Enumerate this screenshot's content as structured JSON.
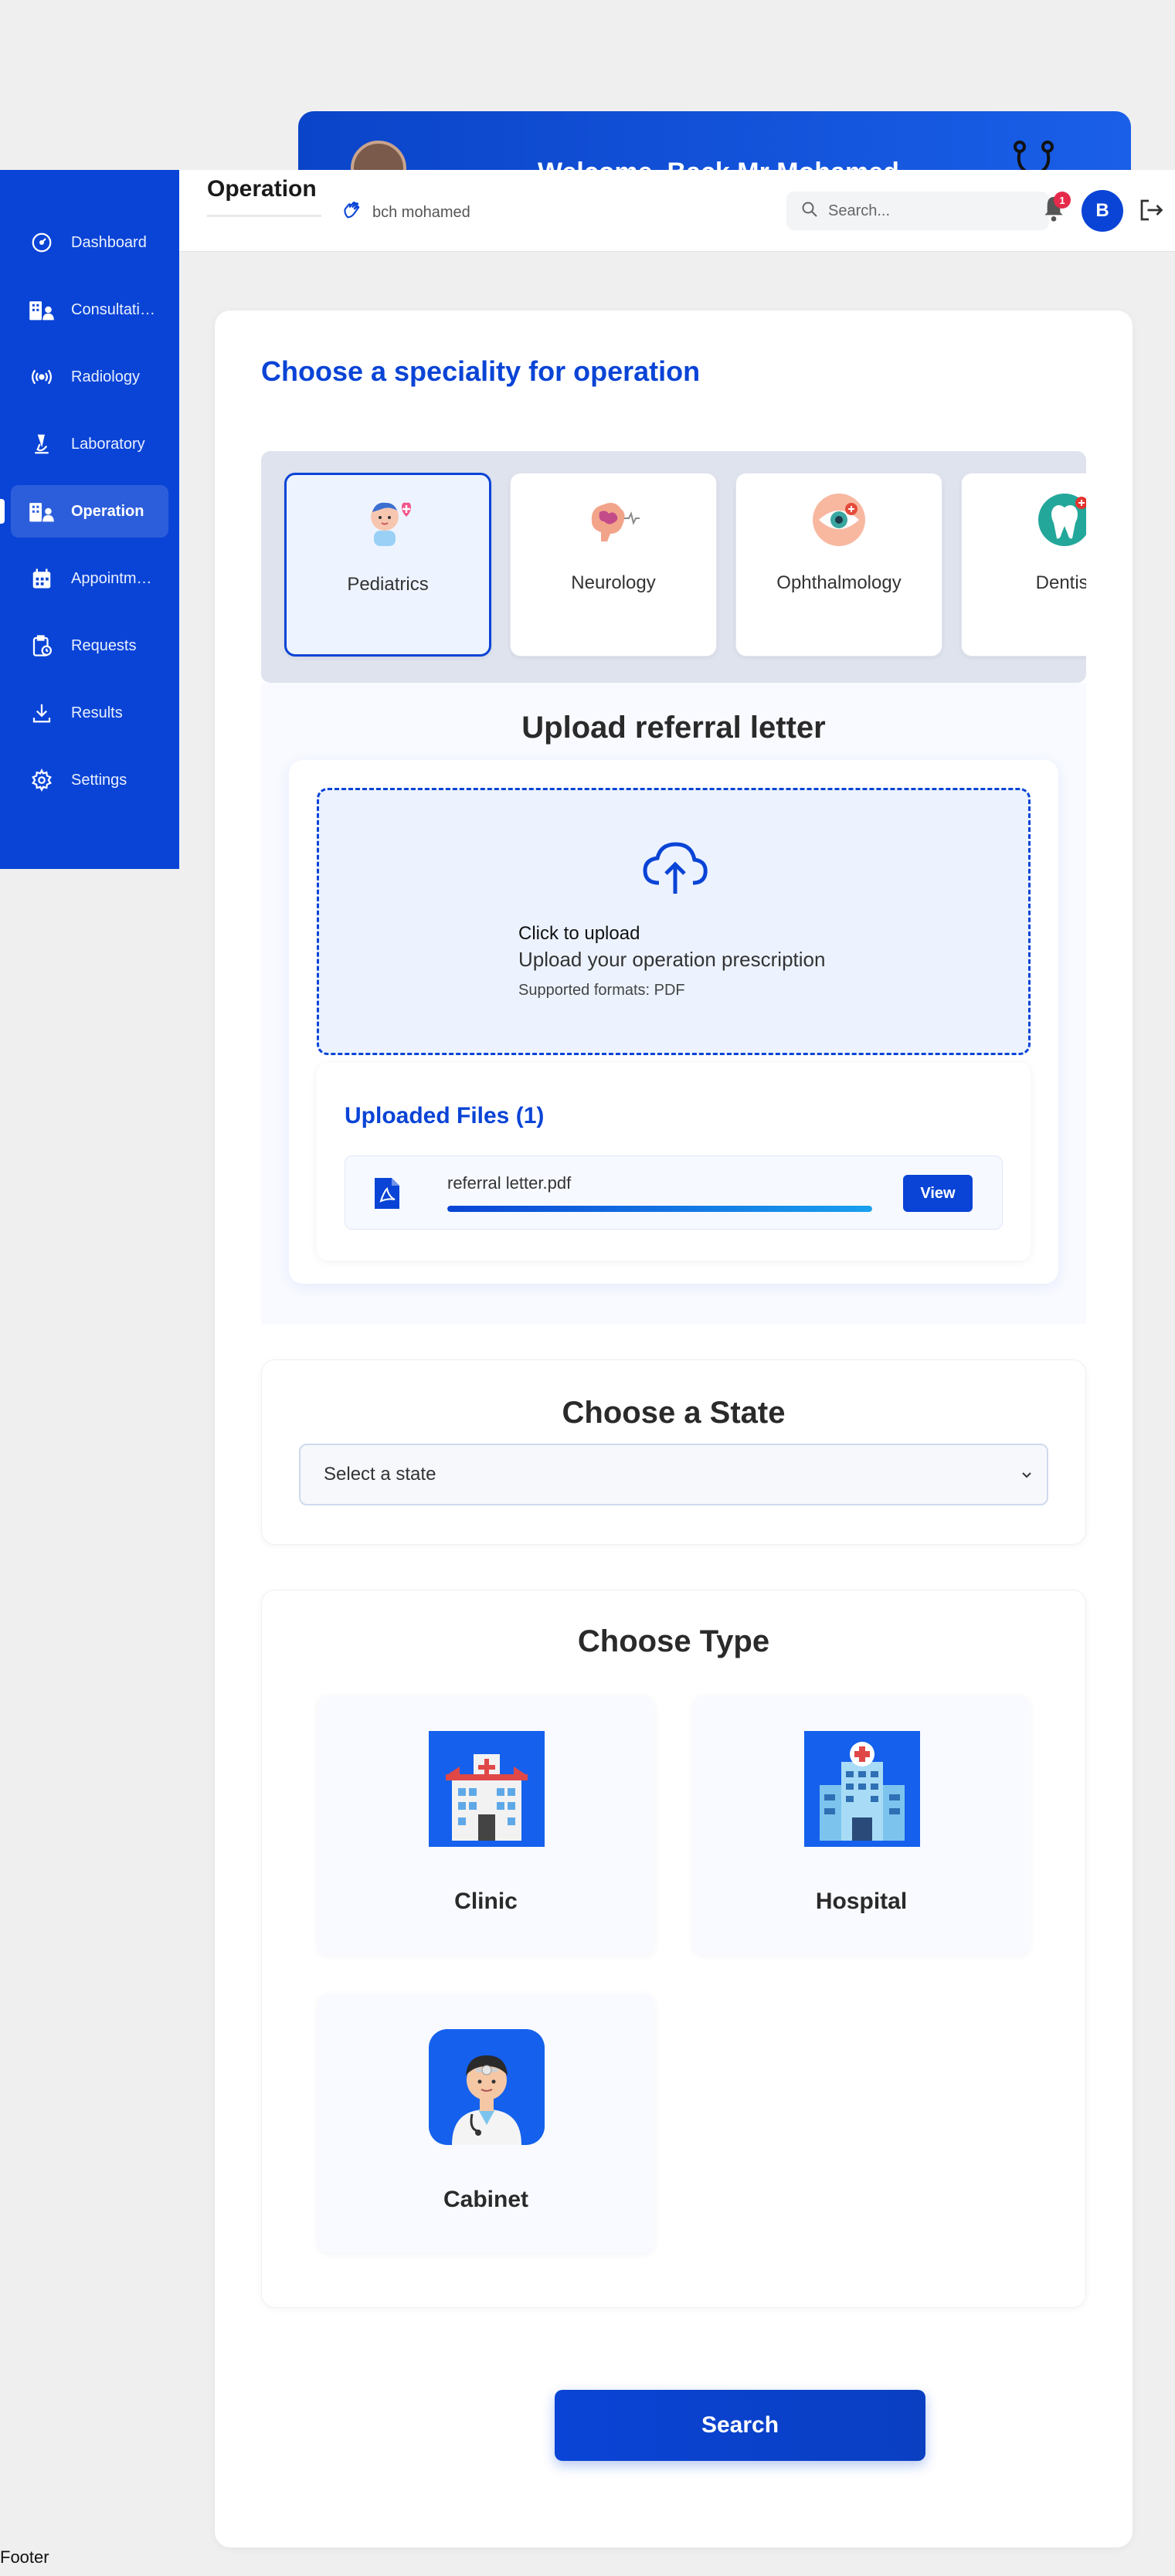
{
  "banner": {
    "welcome_text": "Welcome, Back Mr Mohamed"
  },
  "sidebar": {
    "items": [
      {
        "label": "Dashboard",
        "icon": "gauge-icon",
        "active": false
      },
      {
        "label": "Consultations",
        "icon": "building-user-icon",
        "active": false
      },
      {
        "label": "Radiology",
        "icon": "radio-waves-icon",
        "active": false
      },
      {
        "label": "Laboratory",
        "icon": "microscope-icon",
        "active": false
      },
      {
        "label": "Operation",
        "icon": "building-user-icon",
        "active": true
      },
      {
        "label": "Appointments",
        "icon": "calendar-icon",
        "active": false
      },
      {
        "label": "Requests",
        "icon": "clipboard-clock-icon",
        "active": false
      },
      {
        "label": "Results",
        "icon": "download-icon",
        "active": false
      },
      {
        "label": "Settings",
        "icon": "gear-icon",
        "active": false
      }
    ]
  },
  "header": {
    "title": "Operation",
    "user_name": "bch mohamed",
    "search_placeholder": "Search...",
    "notification_count": "1",
    "avatar_initial": "B"
  },
  "speciality": {
    "heading": "Choose a speciality for operation",
    "items": [
      {
        "label": "Pediatrics",
        "icon": "baby-heart-icon",
        "selected": true
      },
      {
        "label": "Neurology",
        "icon": "brain-icon",
        "selected": false
      },
      {
        "label": "Ophthalmology",
        "icon": "eye-icon",
        "selected": false
      },
      {
        "label": "Dentist",
        "icon": "tooth-icon",
        "selected": false
      }
    ]
  },
  "upload": {
    "title": "Upload referral letter",
    "click_text": "Click to upload",
    "main_text": "Upload your operation prescription",
    "formats_text": "Supported formats: PDF",
    "files_title": "Uploaded Files (1)",
    "files": [
      {
        "name": "referral letter.pdf",
        "progress": 1.0,
        "view_label": "View"
      }
    ]
  },
  "state": {
    "title": "Choose a State",
    "selected_text": "Select a state"
  },
  "type": {
    "title": "Choose Type",
    "items": [
      {
        "label": "Clinic",
        "icon": "clinic-building-icon"
      },
      {
        "label": "Hospital",
        "icon": "hospital-building-icon"
      },
      {
        "label": "Cabinet",
        "icon": "doctor-icon"
      }
    ]
  },
  "actions": {
    "search_label": "Search"
  },
  "footer": {
    "text": "Footer"
  },
  "colors": {
    "primary": "#0a44d6",
    "badge": "#e62a4a",
    "page_bg": "#efefef"
  }
}
